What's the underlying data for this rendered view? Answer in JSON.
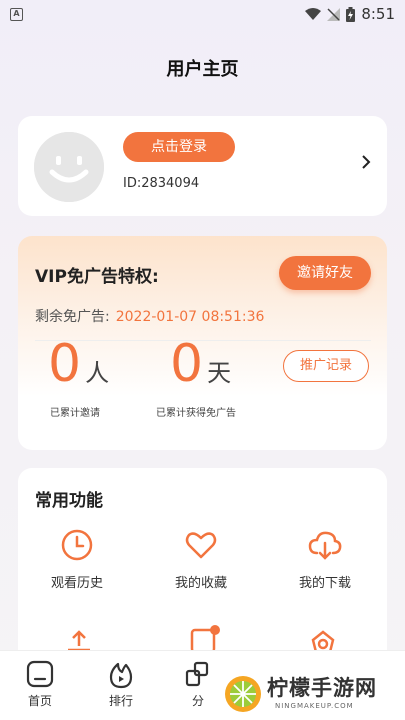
{
  "status_bar": {
    "time": "8:51",
    "app_icon_letter": "A"
  },
  "header": {
    "title": "用户主页"
  },
  "user": {
    "login_label": "点击登录",
    "id_text": "ID:2834094"
  },
  "vip": {
    "title": "VIP免广告特权:",
    "invite_label": "邀请好友",
    "remaining_label": "剩余免广告:",
    "remaining_value": "2022-01-07 08:51:36",
    "people_count": "0",
    "people_unit": "人",
    "people_label": "已累计邀请",
    "days_count": "0",
    "days_unit": "天",
    "days_label": "已累计获得免广告",
    "promo_label": "推广记录"
  },
  "functions": {
    "title": "常用功能",
    "items": [
      {
        "label": "观看历史",
        "icon": "clock-icon"
      },
      {
        "label": "我的收藏",
        "icon": "heart-icon"
      },
      {
        "label": "我的下载",
        "icon": "cloud-download-icon"
      }
    ]
  },
  "tabbar": {
    "items": [
      {
        "label": "首页",
        "icon": "home-icon"
      },
      {
        "label": "排行",
        "icon": "flame-icon"
      },
      {
        "label": "分",
        "icon": "category-icon"
      }
    ]
  },
  "watermark": {
    "text": "柠檬手游网",
    "sub": "NINGMAKEUP.COM"
  },
  "colors": {
    "accent": "#f2743e",
    "vip_gradient_top": "#fde3cc"
  }
}
